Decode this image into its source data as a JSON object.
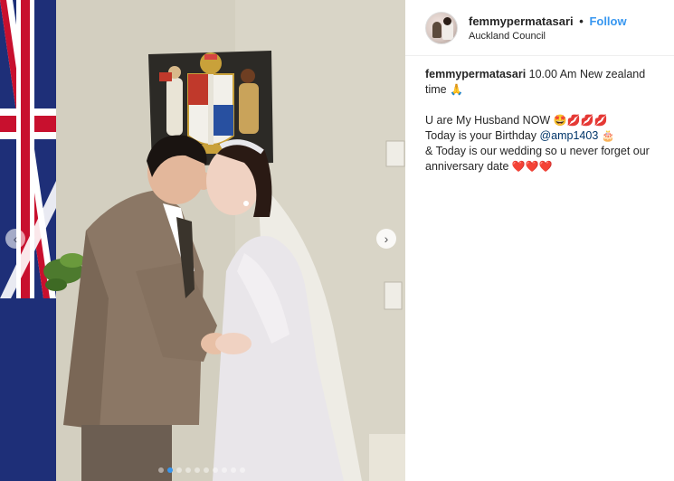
{
  "post": {
    "username": "femmypermatasari",
    "separator": "•",
    "follow_label": "Follow",
    "location": "Auckland Council",
    "caption": {
      "line1": "10.00 Am New zealand time",
      "line1_emoji": "🙏",
      "line2": "U are My Husband NOW",
      "line2_emoji": "🤩💋💋💋",
      "line3": "Today is your Birthday",
      "line3_mention": "@amp1403",
      "line3_emoji": "🎂",
      "line4": "& Today is our wedding so u never forget our anniversary date",
      "line4_emoji": "❤️❤️❤️"
    }
  },
  "carousel": {
    "prev_icon": "chevron-left-icon",
    "next_icon": "chevron-right-icon",
    "prev_glyph": "‹",
    "next_glyph": "›",
    "dot_count": 10,
    "active_dot": 1
  },
  "colors": {
    "follow": "#3897f0",
    "mention": "#003569",
    "active_dot": "#3897f0"
  }
}
